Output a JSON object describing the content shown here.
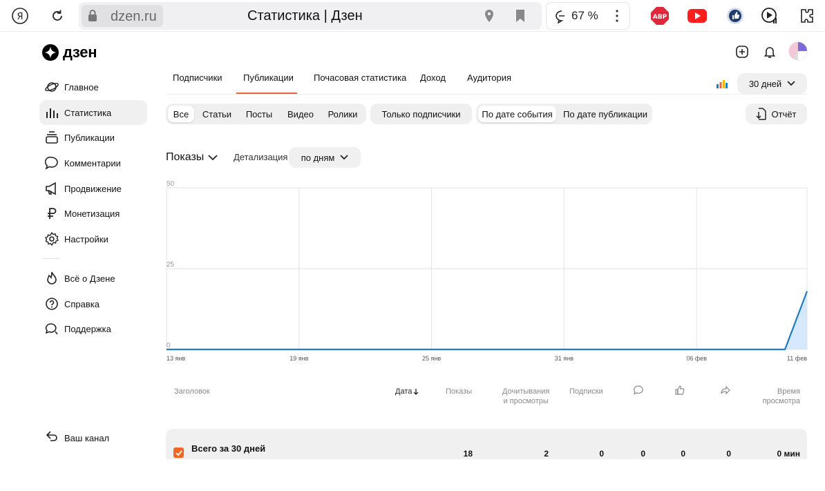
{
  "browser": {
    "domain": "dzen.ru",
    "page_title": "Статистика | Дзен",
    "zoom": "67 %",
    "extensions": [
      "ABP",
      "youtube-icon",
      "thumbs-up-icon",
      "play-icon",
      "puzzle-icon"
    ]
  },
  "brand": {
    "logo_text": "дзен"
  },
  "sidebar": {
    "items": [
      {
        "label": "Главное",
        "icon": "planet-icon"
      },
      {
        "label": "Статистика",
        "icon": "stats-icon",
        "active": true
      },
      {
        "label": "Публикации",
        "icon": "stack-icon"
      },
      {
        "label": "Комментарии",
        "icon": "comment-icon"
      },
      {
        "label": "Продвижение",
        "icon": "megaphone-icon"
      },
      {
        "label": "Монетизация",
        "icon": "ruble-icon"
      },
      {
        "label": "Настройки",
        "icon": "gear-icon"
      }
    ],
    "secondary": [
      {
        "label": "Всё о Дзене",
        "icon": "flame-icon"
      },
      {
        "label": "Справка",
        "icon": "help-icon"
      },
      {
        "label": "Поддержка",
        "icon": "support-icon"
      }
    ],
    "your_channel": "Ваш канал"
  },
  "tabs": [
    {
      "label": "Подписчики"
    },
    {
      "label": "Публикации",
      "active": true
    },
    {
      "label": "Почасовая статистика"
    },
    {
      "label": "Доход"
    },
    {
      "label": "Аудитория"
    }
  ],
  "period": "30 дней",
  "filters": {
    "types": [
      "Все",
      "Статьи",
      "Посты",
      "Видео",
      "Ролики"
    ],
    "subscribers_only": "Только подписчики",
    "date_modes": [
      "По дате события",
      "По дате публикации"
    ],
    "report": "Отчёт"
  },
  "controls": {
    "metric": "Показы",
    "detail_label": "Детализация",
    "detail_value": "по дням"
  },
  "colors": {
    "accent": "#e8623a",
    "checkbox": "#f26522",
    "line": "#1f7bc6",
    "area": "#cfe4fa"
  },
  "chart_data": {
    "type": "area",
    "y_ticks": [
      "0",
      "25",
      "50"
    ],
    "ylim": [
      0,
      50
    ],
    "x_ticks": [
      "13 янв",
      "19 янв",
      "25 янв",
      "31 янв",
      "06 фев",
      "11 фев"
    ],
    "x": [
      "13 янв",
      "14 янв",
      "15 янв",
      "16 янв",
      "17 янв",
      "18 янв",
      "19 янв",
      "20 янв",
      "21 янв",
      "22 янв",
      "23 янв",
      "24 янв",
      "25 янв",
      "26 янв",
      "27 янв",
      "28 янв",
      "29 янв",
      "30 янв",
      "31 янв",
      "01 фев",
      "02 фев",
      "03 фев",
      "04 фев",
      "05 фев",
      "06 фев",
      "07 фев",
      "08 фев",
      "09 фев",
      "10 фев",
      "11 фев"
    ],
    "series": [
      {
        "values": [
          0,
          0,
          0,
          0,
          0,
          0,
          0,
          0,
          0,
          0,
          0,
          0,
          0,
          0,
          0,
          0,
          0,
          0,
          0,
          0,
          0,
          0,
          0,
          0,
          0,
          0,
          0,
          0,
          0,
          18
        ]
      }
    ],
    "grid": true
  },
  "table": {
    "headers": {
      "title": "Заголовок",
      "date": "Дата",
      "views": "Показы",
      "reads_line1": "Дочитывания",
      "reads_line2": "и просмотры",
      "subs": "Подписки",
      "time_line1": "Время",
      "time_line2": "просмотра"
    },
    "header_icons": [
      "comment-icon",
      "like-icon",
      "share-icon"
    ],
    "total_row": {
      "title": "Всего за 30 дней",
      "views": "18",
      "reads": "2",
      "subs": "0",
      "comments": "0",
      "likes": "0",
      "shares": "0",
      "time": "0 мин"
    }
  }
}
